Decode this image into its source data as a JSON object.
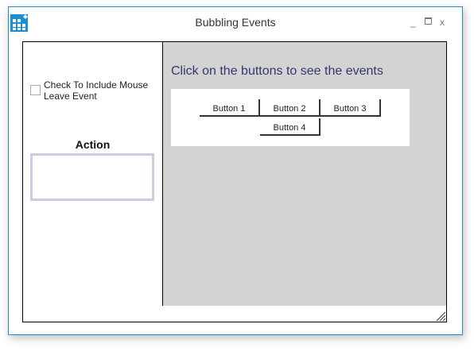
{
  "window": {
    "title": "Bubbling Events",
    "controls": {
      "minimize": "_",
      "close": "x"
    }
  },
  "left_panel": {
    "checkbox_label": "Check To Include Mouse Leave Event",
    "checkbox_checked": false,
    "action_label": "Action",
    "action_value": ""
  },
  "right_panel": {
    "instruction": "Click on the buttons to see the events",
    "buttons": [
      "Button 1",
      "Button 2",
      "Button 3",
      "Button 4"
    ]
  },
  "colors": {
    "accent": "#1b8fd1",
    "instruction_text": "#34386f",
    "right_panel_bg": "#d3d3d3"
  }
}
